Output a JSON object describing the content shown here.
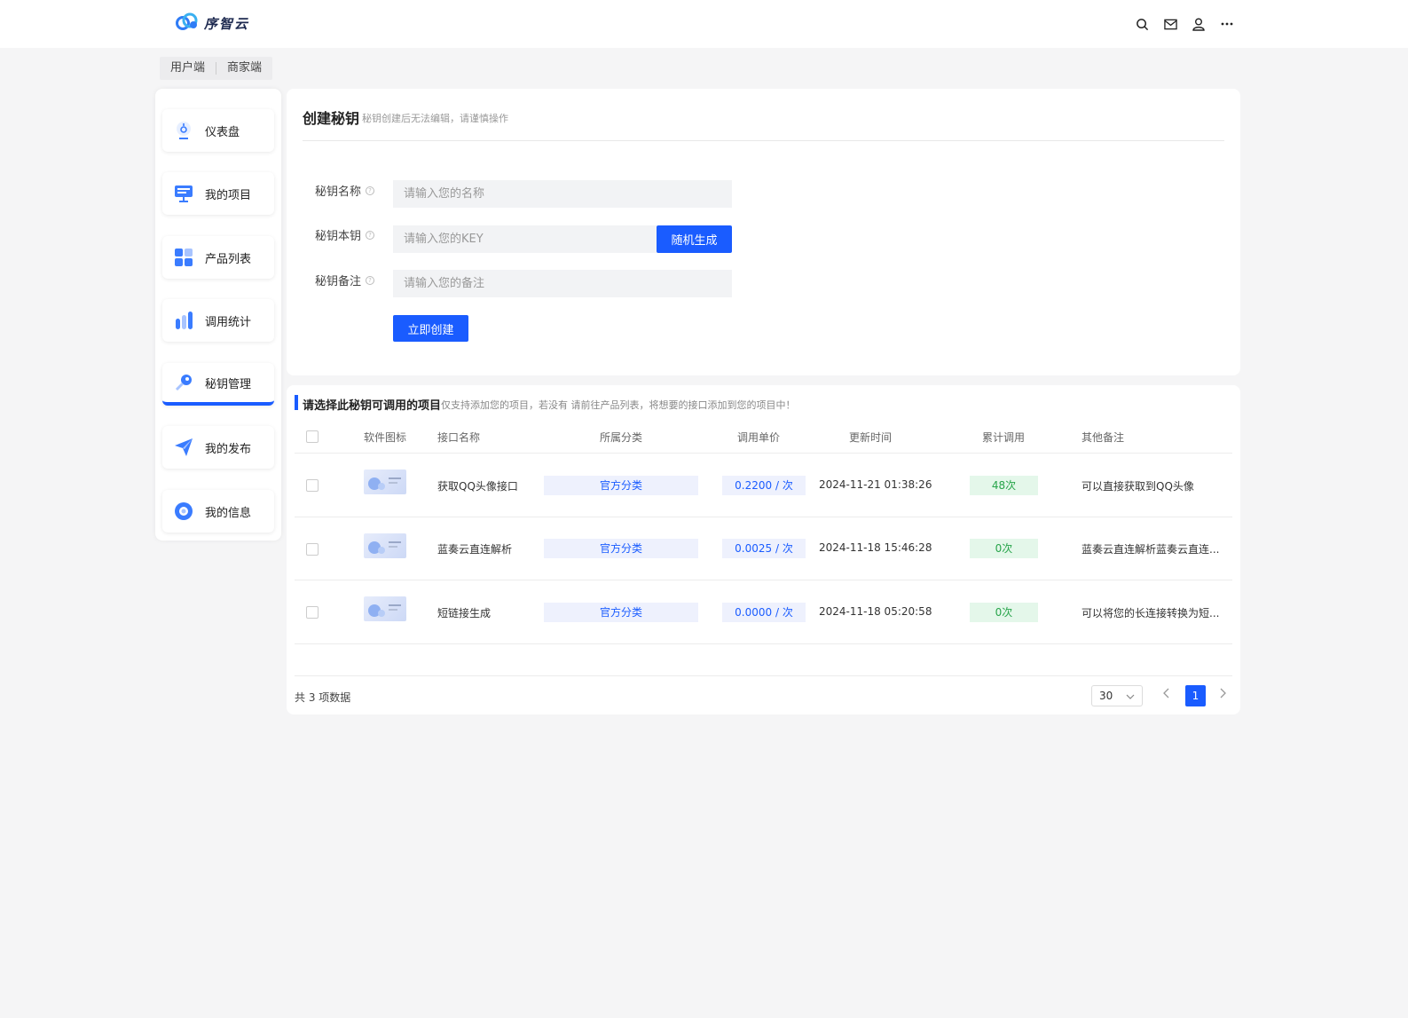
{
  "header": {
    "logo_text": "序智云",
    "icons": [
      "search-icon",
      "mail-icon",
      "user-icon",
      "more-icon"
    ]
  },
  "role_tabs": [
    "用户端",
    "商家端"
  ],
  "sidebar": {
    "items": [
      {
        "label": "仪表盘",
        "icon": "dashboard-icon"
      },
      {
        "label": "我的项目",
        "icon": "project-icon"
      },
      {
        "label": "产品列表",
        "icon": "grid-icon"
      },
      {
        "label": "调用统计",
        "icon": "bar-chart-icon"
      },
      {
        "label": "秘钥管理",
        "icon": "key-icon",
        "active": true
      },
      {
        "label": "我的发布",
        "icon": "send-icon"
      },
      {
        "label": "我的信息",
        "icon": "info-icon"
      }
    ]
  },
  "create_key": {
    "title": "创建秘钥",
    "subtitle": "秘钥创建后无法编辑，请谨慎操作",
    "name_label": "秘钥名称",
    "name_placeholder": "请输入您的名称",
    "key_label": "秘钥本钥",
    "key_placeholder": "请输入您的KEY",
    "random_button": "随机生成",
    "remark_label": "秘钥备注",
    "remark_placeholder": "请输入您的备注",
    "submit_button": "立即创建"
  },
  "project_select": {
    "title": "请选择此秘钥可调用的项目",
    "subtitle": "仅支持添加您的项目，若没有 请前往产品列表，将想要的接口添加到您的项目中！",
    "columns": [
      "软件图标",
      "接口名称",
      "所属分类",
      "调用单价",
      "更新时间",
      "累计调用",
      "其他备注"
    ],
    "rows": [
      {
        "name": "获取QQ头像接口",
        "category": "官方分类",
        "price": "0.2200 / 次",
        "updated": "2024-11-21 01:38:26",
        "calls": "48次",
        "remark": "可以直接获取到QQ头像"
      },
      {
        "name": "蓝奏云直连解析",
        "category": "官方分类",
        "price": "0.0025 / 次",
        "updated": "2024-11-18 15:46:28",
        "calls": "0次",
        "remark": "蓝奏云直连解析蓝奏云直连..."
      },
      {
        "name": "短链接生成",
        "category": "官方分类",
        "price": "0.0000 / 次",
        "updated": "2024-11-18 05:20:58",
        "calls": "0次",
        "remark": "可以将您的长连接转换为短..."
      }
    ],
    "total_text": "共 3 项数据",
    "page_size": "30",
    "current_page": "1"
  },
  "colors": {
    "accent": "#1a5cff",
    "success": "#27a44a",
    "background": "#f5f5f6"
  }
}
